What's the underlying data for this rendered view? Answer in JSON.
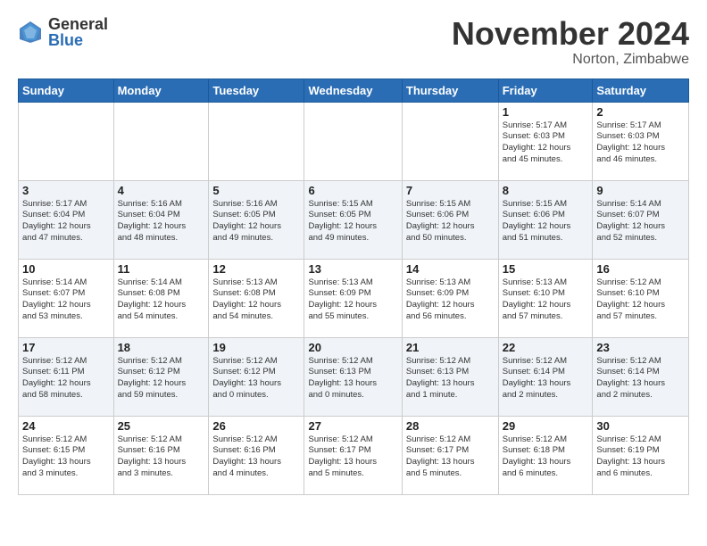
{
  "header": {
    "logo_general": "General",
    "logo_blue": "Blue",
    "month_title": "November 2024",
    "location": "Norton, Zimbabwe"
  },
  "weekdays": [
    "Sunday",
    "Monday",
    "Tuesday",
    "Wednesday",
    "Thursday",
    "Friday",
    "Saturday"
  ],
  "weeks": [
    [
      {
        "day": "",
        "info": ""
      },
      {
        "day": "",
        "info": ""
      },
      {
        "day": "",
        "info": ""
      },
      {
        "day": "",
        "info": ""
      },
      {
        "day": "",
        "info": ""
      },
      {
        "day": "1",
        "info": "Sunrise: 5:17 AM\nSunset: 6:03 PM\nDaylight: 12 hours\nand 45 minutes."
      },
      {
        "day": "2",
        "info": "Sunrise: 5:17 AM\nSunset: 6:03 PM\nDaylight: 12 hours\nand 46 minutes."
      }
    ],
    [
      {
        "day": "3",
        "info": "Sunrise: 5:17 AM\nSunset: 6:04 PM\nDaylight: 12 hours\nand 47 minutes."
      },
      {
        "day": "4",
        "info": "Sunrise: 5:16 AM\nSunset: 6:04 PM\nDaylight: 12 hours\nand 48 minutes."
      },
      {
        "day": "5",
        "info": "Sunrise: 5:16 AM\nSunset: 6:05 PM\nDaylight: 12 hours\nand 49 minutes."
      },
      {
        "day": "6",
        "info": "Sunrise: 5:15 AM\nSunset: 6:05 PM\nDaylight: 12 hours\nand 49 minutes."
      },
      {
        "day": "7",
        "info": "Sunrise: 5:15 AM\nSunset: 6:06 PM\nDaylight: 12 hours\nand 50 minutes."
      },
      {
        "day": "8",
        "info": "Sunrise: 5:15 AM\nSunset: 6:06 PM\nDaylight: 12 hours\nand 51 minutes."
      },
      {
        "day": "9",
        "info": "Sunrise: 5:14 AM\nSunset: 6:07 PM\nDaylight: 12 hours\nand 52 minutes."
      }
    ],
    [
      {
        "day": "10",
        "info": "Sunrise: 5:14 AM\nSunset: 6:07 PM\nDaylight: 12 hours\nand 53 minutes."
      },
      {
        "day": "11",
        "info": "Sunrise: 5:14 AM\nSunset: 6:08 PM\nDaylight: 12 hours\nand 54 minutes."
      },
      {
        "day": "12",
        "info": "Sunrise: 5:13 AM\nSunset: 6:08 PM\nDaylight: 12 hours\nand 54 minutes."
      },
      {
        "day": "13",
        "info": "Sunrise: 5:13 AM\nSunset: 6:09 PM\nDaylight: 12 hours\nand 55 minutes."
      },
      {
        "day": "14",
        "info": "Sunrise: 5:13 AM\nSunset: 6:09 PM\nDaylight: 12 hours\nand 56 minutes."
      },
      {
        "day": "15",
        "info": "Sunrise: 5:13 AM\nSunset: 6:10 PM\nDaylight: 12 hours\nand 57 minutes."
      },
      {
        "day": "16",
        "info": "Sunrise: 5:12 AM\nSunset: 6:10 PM\nDaylight: 12 hours\nand 57 minutes."
      }
    ],
    [
      {
        "day": "17",
        "info": "Sunrise: 5:12 AM\nSunset: 6:11 PM\nDaylight: 12 hours\nand 58 minutes."
      },
      {
        "day": "18",
        "info": "Sunrise: 5:12 AM\nSunset: 6:12 PM\nDaylight: 12 hours\nand 59 minutes."
      },
      {
        "day": "19",
        "info": "Sunrise: 5:12 AM\nSunset: 6:12 PM\nDaylight: 13 hours\nand 0 minutes."
      },
      {
        "day": "20",
        "info": "Sunrise: 5:12 AM\nSunset: 6:13 PM\nDaylight: 13 hours\nand 0 minutes."
      },
      {
        "day": "21",
        "info": "Sunrise: 5:12 AM\nSunset: 6:13 PM\nDaylight: 13 hours\nand 1 minute."
      },
      {
        "day": "22",
        "info": "Sunrise: 5:12 AM\nSunset: 6:14 PM\nDaylight: 13 hours\nand 2 minutes."
      },
      {
        "day": "23",
        "info": "Sunrise: 5:12 AM\nSunset: 6:14 PM\nDaylight: 13 hours\nand 2 minutes."
      }
    ],
    [
      {
        "day": "24",
        "info": "Sunrise: 5:12 AM\nSunset: 6:15 PM\nDaylight: 13 hours\nand 3 minutes."
      },
      {
        "day": "25",
        "info": "Sunrise: 5:12 AM\nSunset: 6:16 PM\nDaylight: 13 hours\nand 3 minutes."
      },
      {
        "day": "26",
        "info": "Sunrise: 5:12 AM\nSunset: 6:16 PM\nDaylight: 13 hours\nand 4 minutes."
      },
      {
        "day": "27",
        "info": "Sunrise: 5:12 AM\nSunset: 6:17 PM\nDaylight: 13 hours\nand 5 minutes."
      },
      {
        "day": "28",
        "info": "Sunrise: 5:12 AM\nSunset: 6:17 PM\nDaylight: 13 hours\nand 5 minutes."
      },
      {
        "day": "29",
        "info": "Sunrise: 5:12 AM\nSunset: 6:18 PM\nDaylight: 13 hours\nand 6 minutes."
      },
      {
        "day": "30",
        "info": "Sunrise: 5:12 AM\nSunset: 6:19 PM\nDaylight: 13 hours\nand 6 minutes."
      }
    ]
  ]
}
